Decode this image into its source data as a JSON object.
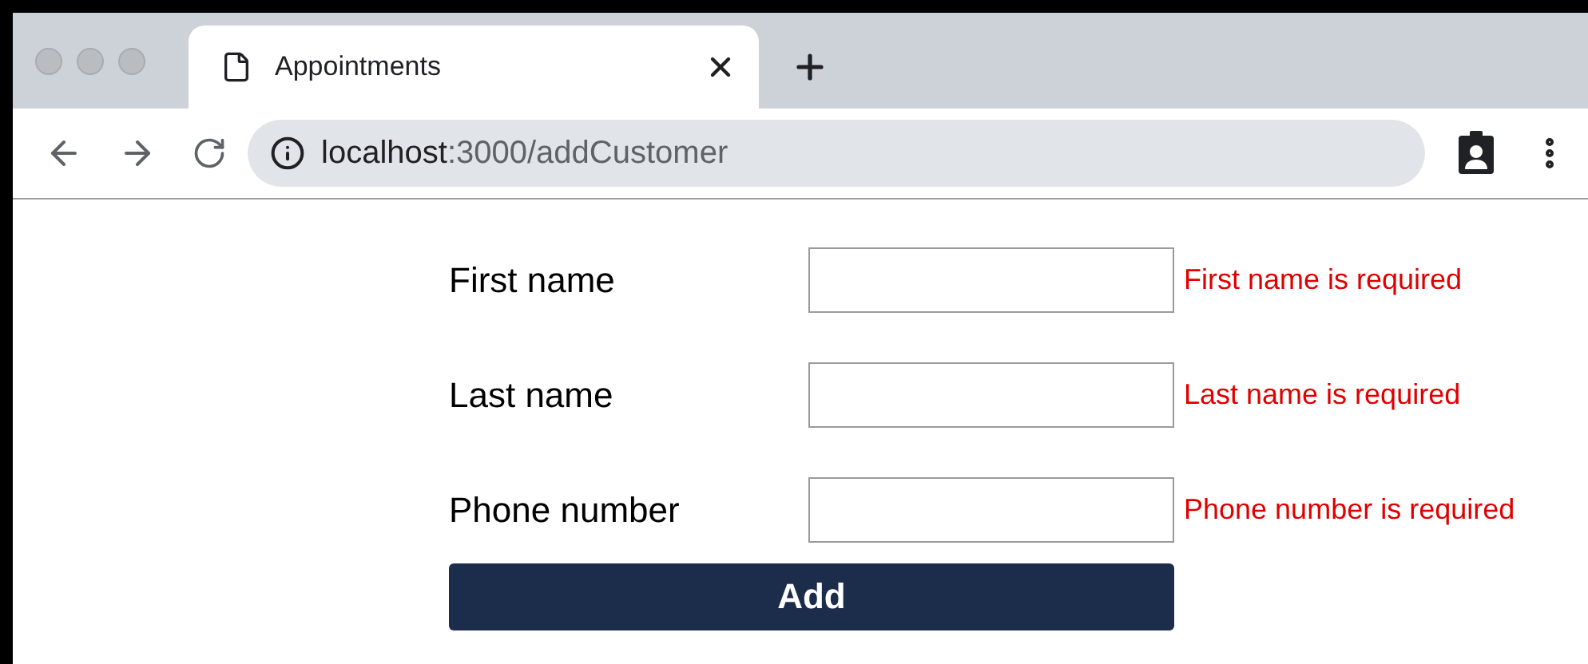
{
  "browser": {
    "tab": {
      "title": "Appointments"
    },
    "address": {
      "host": "localhost",
      "path": ":3000/addCustomer"
    }
  },
  "form": {
    "fields": [
      {
        "label": "First name",
        "error": "First name is required"
      },
      {
        "label": "Last name",
        "error": "Last name is required"
      },
      {
        "label": "Phone number",
        "error": "Phone number is required"
      }
    ],
    "submit": "Add"
  }
}
